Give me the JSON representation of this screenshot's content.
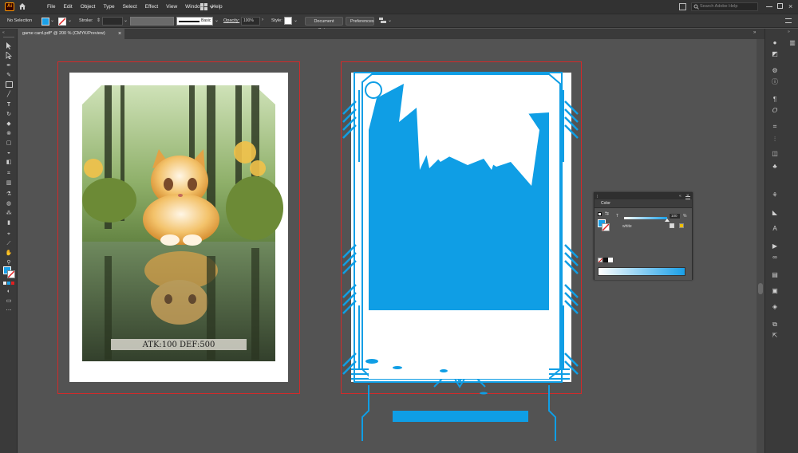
{
  "app": {
    "logo_text": "Ai",
    "search_placeholder": "Search Adobe Help"
  },
  "menu": [
    "File",
    "Edit",
    "Object",
    "Type",
    "Select",
    "Effect",
    "View",
    "Window",
    "Help"
  ],
  "control_bar": {
    "selection_text": "No Selection",
    "stroke_label": "Stroke:",
    "brush_label": "Basic",
    "opacity_label": "Opacity:",
    "opacity_value": "100%",
    "style_label": "Style:",
    "document_setup": "Document Setup",
    "preferences": "Preferences"
  },
  "document_tab": {
    "title": "game card.pdf* @ 200 % (CMYK/Preview)",
    "close": "×"
  },
  "card_left": {
    "stats_text": "ATK:100 DEF:500"
  },
  "color_panel": {
    "title": "Color",
    "channel_label": "T",
    "channel_value": "100",
    "unit": "%",
    "swatch_name": "white",
    "accent": "#1aa0e8"
  },
  "colors": {
    "ui_dark": "#323232",
    "canvas": "#535353",
    "bleed": "#d22a2a",
    "cyan": "#0f9ee5"
  }
}
